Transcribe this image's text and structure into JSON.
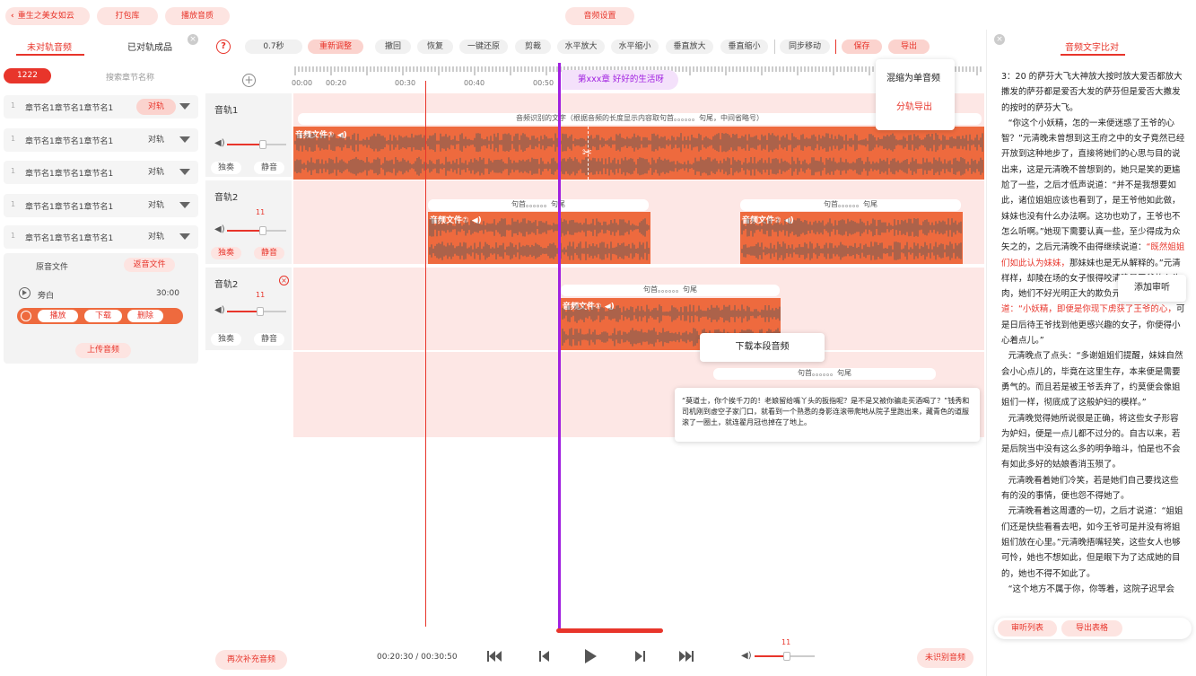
{
  "header": {
    "back_label": "重生之美女如云",
    "pack_label": "打包库",
    "playlist_label": "播放音质",
    "center_title": "音频设置"
  },
  "left_panel": {
    "tab_unaligned": "未对轨音频",
    "tab_aligned": "已对轨成品",
    "chapter_count": "1222",
    "search_placeholder": "搜索章节名称",
    "chapters": [
      {
        "num": "1",
        "name": "章节名1章节名1章节名1",
        "action": "对轨",
        "active": true
      },
      {
        "num": "1",
        "name": "章节名1章节名1章节名1",
        "action": "对轨",
        "active": false
      },
      {
        "num": "1",
        "name": "章节名1章节名1章节名1",
        "action": "对轨",
        "active": false
      },
      {
        "num": "1",
        "name": "章节名1章节名1章节名1",
        "action": "对轨",
        "active": false
      },
      {
        "num": "1",
        "name": "章节名1章节名1章节名1",
        "action": "对轨",
        "active": false
      }
    ],
    "tab_original": "原音文件",
    "tab_return": "返音文件",
    "narration_label": "旁白",
    "narration_time": "30:00",
    "btn_play": "播放",
    "btn_download": "下载",
    "btn_delete": "删除",
    "btn_upload": "上传音频",
    "btn_resupply": "再次补充音频"
  },
  "toolbar": {
    "speed": "0.7秒",
    "readjust": "重新调整",
    "undo": "撤回",
    "redo": "恢复",
    "restore": "一键还原",
    "cut": "剪裁",
    "h_zoom_in": "水平放大",
    "h_zoom_out": "水平缩小",
    "v_zoom_in": "垂直放大",
    "v_zoom_out": "垂直缩小",
    "sync_move": "同步移动",
    "save": "保存",
    "export": "导出"
  },
  "export_menu": {
    "mix_single": "混缩为单音频",
    "split_export": "分轨导出"
  },
  "ruler": {
    "ticks": [
      "00:00",
      "00:20",
      "00:30",
      "00:40",
      "00:50"
    ],
    "chapter_flag": "第xxx章 好好的生活呀"
  },
  "tracks": [
    {
      "name": "音轨1",
      "volume": "",
      "solo": "独奏",
      "mute": "静音",
      "solo_active": false,
      "mute_active": false,
      "level": 0.6
    },
    {
      "name": "音轨2",
      "volume": "11",
      "solo": "独奏",
      "mute": "静音",
      "solo_active": true,
      "mute_active": true,
      "level": 0.6
    },
    {
      "name": "音轨2",
      "volume": "11",
      "solo": "独奏",
      "mute": "静音",
      "solo_active": false,
      "mute_active": false,
      "level": 0.55
    }
  ],
  "clips": {
    "track1_caption": "音频识别的文字（根据音频的长度显示内容取句首。。。。。。句尾，中间省略号）",
    "track1_label": "音频文件①",
    "track2a_caption": "句首。。。。。。句尾",
    "track2a_label": "音频文件①",
    "track2b_caption": "句首。。。。。。句尾",
    "track2b_label": "音频文件②",
    "track3_caption": "句首。。。。。。句尾",
    "track3_label": "音频文件①",
    "track4_caption": "句首。。。。。。句尾"
  },
  "popups": {
    "download_segment": "下载本段音频",
    "add_review": "添加审听",
    "recognized_text": "“莫道士，你个挨千刀的！老娘留给嘴丫头的扳指呢？是不是又被你骗走买酒喝了？”钱秀和司机刚到虚空子家门口，就看到一个熟悉的身影连滚带爬地从院子里跑出来，藏青色的道服滚了一圈土，就连翟月冠也掉在了地上。"
  },
  "transport": {
    "time": "00:20:30 / 00:30:50",
    "volume": "11",
    "unrecognized_btn": "未识别音频"
  },
  "right_panel": {
    "title": "音频文字比对",
    "paragraphs": [
      [
        {
          "t": "3：20 的萨芬大飞大神放大按时放大爱否都放大撒发的萨芬都是爱否大发的萨芬但是爱否大撒发的按时的萨芬大飞。",
          "hl": false
        }
      ],
      [
        {
          "t": "“你这个小妖精，怎的一来便迷惑了王爷的心智？”元清晚未曾想到这王府之中的女子竟然已经开放到这种地步了，直接将她们的心思与目的说出来，这是元清晚不曾想到的，她只是笑的更尴尬了一些，之后才低声说道：“并不是我想要如此，诸位姐姐应该也看到了，是王爷他如此做，妹妹也没有什么办法啊。这功也劝了，王爷也不怎么听啊。”她现下需要认真一些，至少得成为众矢之的，之后元清晚不由得继续说道：",
          "hl": false
        },
        {
          "t": "“既然姐姐们如此认为妹妹，",
          "hl": true
        },
        {
          "t": "那妹妹也是无从解释的。”元清",
          "hl": false
        },
        {
          "t": "样样，却陵在场的女子恨得咬",
          "hl": false
        },
        {
          "t": "清晚是王爷的心头肉，她们不好光明正大的欺负元清晚，",
          "hl": false
        },
        {
          "t": "只能说道：“小妖精，即便是你现下虏获了王爷的心，",
          "hl": true
        },
        {
          "t": "可是日后待王爷找到他更感兴趣的女子，你便得小心着点儿。”",
          "hl": false
        }
      ],
      [
        {
          "t": "元清晚点了点头：“多谢姐姐们提醒，妹妹自然会小心点儿的，毕竟在这里生存，本来便是需要勇气的。而且若是被王爷丢弃了，约莫便会像姐姐们一样，彻底成了这般妒妇的模样。”",
          "hl": false
        }
      ],
      [
        {
          "t": "元清晚觉得她所说很是正确，将这些女子形容为妒妇，便是一点儿都不过分的。自古以来，若是后院当中没有这么多的明争暗斗，怕是也不会有如此多好的姑娘香消玉殒了。",
          "hl": false
        }
      ],
      [
        {
          "t": "元清晚看着她们冷笑，若是她们自己要找这些有的没的事情，便也怨不得她了。",
          "hl": false
        }
      ],
      [
        {
          "t": "元清晚看着这周遭的一切，之后才说道：“姐姐们还是快些看看去吧，如今王爷可是并没有将姐姐们放在心里。”元清晚捂嘴轻笑，这些女人也够可怜，她也不想如此，但是眼下为了达成她的目的，她也不得不如此了。",
          "hl": false
        }
      ],
      [
        {
          "t": "“这个地方不属于你，你等着，这院子迟早会",
          "hl": false
        }
      ]
    ],
    "btn_review_list": "审听列表",
    "btn_export_table": "导出表格"
  },
  "colors": {
    "accent": "#e8352b",
    "clip": "#ee6a3e",
    "playhead": "#a020e0",
    "lane": "#fde7e5"
  }
}
